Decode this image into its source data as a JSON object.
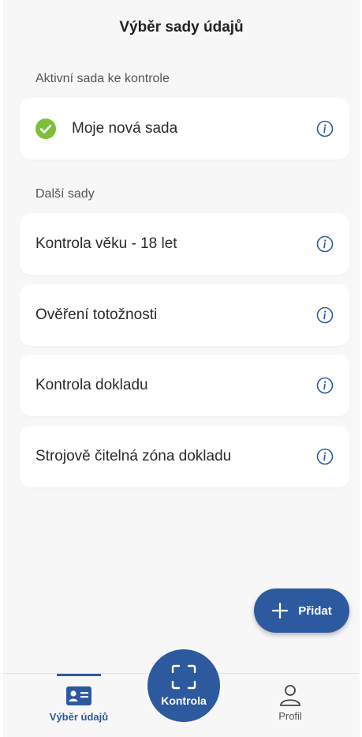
{
  "header": {
    "title": "Výběr sady údajů"
  },
  "active_section": {
    "label": "Aktivní sada ke kontrole",
    "item": {
      "label": "Moje nová sada",
      "status_icon": "check-circle-icon"
    }
  },
  "other_section": {
    "label": "Další sady",
    "items": [
      {
        "label": "Kontrola věku - 18 let"
      },
      {
        "label": "Ověření totožnosti"
      },
      {
        "label": "Kontrola dokladu"
      },
      {
        "label": "Strojově čitelná zóna dokladu"
      }
    ]
  },
  "fab": {
    "label": "Přidat",
    "icon": "plus-icon"
  },
  "bottom_nav": {
    "items": [
      {
        "label": "Výběr údajů",
        "icon": "id-card-icon",
        "active": true
      },
      {
        "label": "Kontrola",
        "icon": "scan-icon"
      },
      {
        "label": "Profil",
        "icon": "person-icon"
      }
    ]
  },
  "colors": {
    "primary": "#2d5a9e",
    "success": "#7cc03a",
    "background": "#f7f7f7"
  }
}
